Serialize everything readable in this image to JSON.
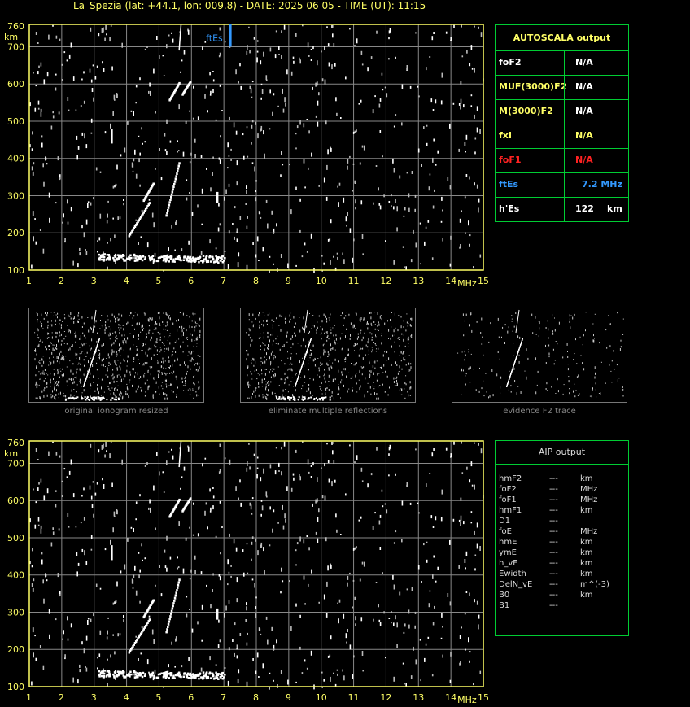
{
  "title": "La_Spezia (lat: +44.1, lon: 009.8) - DATE: 2025 06 05 - TIME (UT): 11:15",
  "axis": {
    "km_label": "km",
    "mhz_label": "MHz",
    "y_ticks": [
      "760",
      "700",
      "600",
      "500",
      "400",
      "300",
      "200",
      "100"
    ],
    "x_ticks": [
      "1",
      "2",
      "3",
      "4",
      "5",
      "6",
      "7",
      "8",
      "9",
      "10",
      "11",
      "12",
      "13",
      "14",
      "15"
    ]
  },
  "ftes_marker_label": "ftEs",
  "colors": {
    "grid": "#cccccc",
    "border": "#ffff66",
    "panel": "#00cc33",
    "ftes": "#3399ff",
    "fof1": "#ff2222",
    "value": "#ffff66"
  },
  "autoscala": {
    "header": "AUTOSCALA output",
    "rows": [
      {
        "label": "foF2",
        "value": "N/A",
        "unit": ""
      },
      {
        "label": "MUF(3000)F2",
        "value": "N/A",
        "unit": ""
      },
      {
        "label": "M(3000)F2",
        "value": "N/A",
        "unit": ""
      },
      {
        "label": "fxI",
        "value": "N/A",
        "unit": ""
      },
      {
        "label": "foF1",
        "value": "N/A",
        "unit": ""
      },
      {
        "label": "ftEs",
        "value": "7.2 MHz",
        "unit": ""
      },
      {
        "label": "h'Es",
        "value": "122",
        "unit": "km"
      }
    ]
  },
  "thumbnails": [
    {
      "caption": "original ionogram resized"
    },
    {
      "caption": "eliminate multiple reflections"
    },
    {
      "caption": "evidence F2 trace"
    }
  ],
  "aip": {
    "header": "AIP output",
    "rows": [
      {
        "label": "hmF2",
        "value": "---",
        "unit": "km"
      },
      {
        "label": "foF2",
        "value": "---",
        "unit": "MHz"
      },
      {
        "label": "foF1",
        "value": "---",
        "unit": "MHz"
      },
      {
        "label": "hmF1",
        "value": "---",
        "unit": "km"
      },
      {
        "label": "D1",
        "value": "---",
        "unit": ""
      },
      {
        "label": "foE",
        "value": "---",
        "unit": "MHz"
      },
      {
        "label": "hmE",
        "value": "---",
        "unit": "km"
      },
      {
        "label": "ymE",
        "value": "---",
        "unit": "km"
      },
      {
        "label": "h_vE",
        "value": "---",
        "unit": "km"
      },
      {
        "label": "Ewidth",
        "value": "---",
        "unit": "km"
      },
      {
        "label": "DelN_vE",
        "value": "---",
        "unit": "m^(-3)"
      },
      {
        "label": "B0",
        "value": "---",
        "unit": "km"
      },
      {
        "label": "B1",
        "value": "---",
        "unit": ""
      }
    ]
  }
}
